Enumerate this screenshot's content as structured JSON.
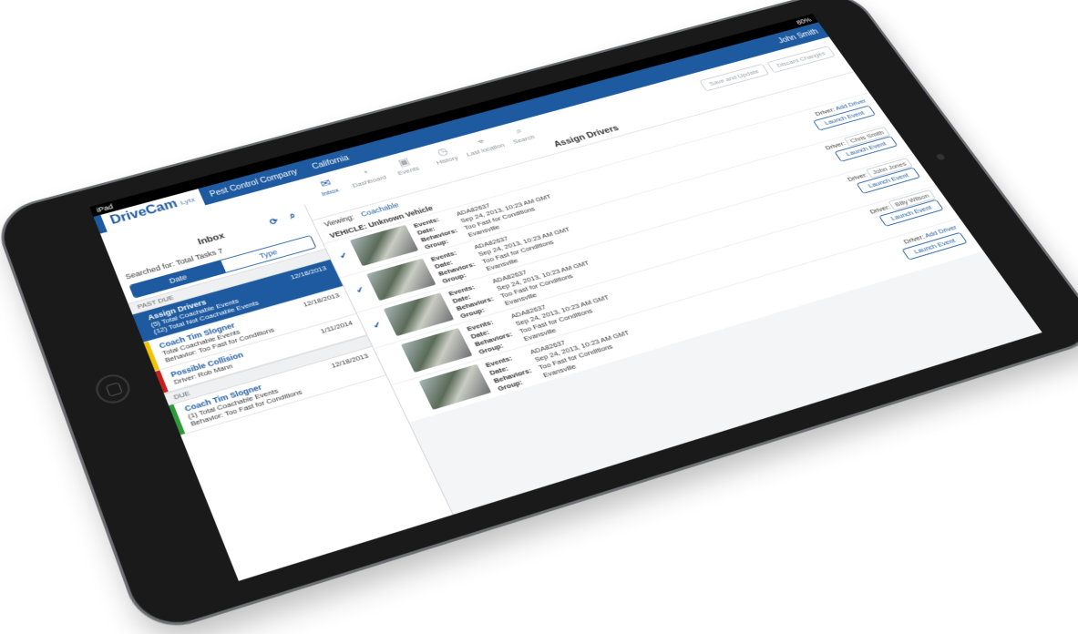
{
  "statusbar": {
    "device": "iPad",
    "battery": "80%"
  },
  "header": {
    "logo": "DriveCam",
    "logo_sub": "Lytx",
    "company": "Pest Control Company",
    "region": "California",
    "user": "John Smith"
  },
  "nav": {
    "items": [
      {
        "label": "Inbox",
        "icon": "inbox-icon"
      },
      {
        "label": "Dashboard",
        "icon": "dashboard-icon"
      },
      {
        "label": "Events",
        "icon": "events-icon"
      },
      {
        "label": "History",
        "icon": "history-icon"
      },
      {
        "label": "Last location",
        "icon": "location-icon"
      },
      {
        "label": "Search",
        "icon": "search-icon"
      }
    ],
    "save_label": "Save and Update",
    "discard_label": "Discard Changes"
  },
  "sidebar": {
    "title": "Inbox",
    "searched": "Searched for: Total Tasks 7",
    "seg_date": "Date",
    "seg_type": "Type",
    "past_due": "PAST DUE",
    "due": "DUE",
    "tasks": [
      {
        "title": "Assign Drivers",
        "line1": "(5) Total Coachable Events",
        "line2": "(12) Total Not Coachable Events",
        "date": "12/18/2013",
        "color": "#1d5aa0"
      },
      {
        "title": "Coach Tim Slogner",
        "line1": "Total Coachable Events",
        "line2": "Behavior: Too Fast for Conditions",
        "date": "12/18/2013",
        "color": "#f2c200"
      },
      {
        "title": "Possible Collision",
        "line1": "Driver: Rob Mann",
        "line2": "",
        "date": "1/11/2014",
        "color": "#c8201e"
      },
      {
        "title": "Coach Tim Slogner",
        "line1": "(1) Total Coachable Events",
        "line2": "Behavior: Too Fast for Conditions",
        "date": "12/18/2013",
        "color": "#2e9a3b"
      }
    ]
  },
  "main": {
    "title": "Assign Drivers",
    "viewing_label": "Viewing:",
    "viewing_value": "Coachable",
    "vehicle": "VEHICLE: Unknown Vehicle",
    "driver_label": "Driver:",
    "add_driver": "Add Driver",
    "launch": "Launch Event",
    "events": [
      {
        "events": "ADA82637",
        "date": "Sep 24, 2013, 10:23 AM GMT",
        "behaviors": "Too Fast for Conditions",
        "group": "Evansville",
        "driver": "",
        "checked": true
      },
      {
        "events": "ADA82637",
        "date": "Sep 24, 2013, 10:23 AM GMT",
        "behaviors": "Too Fast for Conditions",
        "group": "Evansville",
        "driver": "Chris Smith",
        "checked": true
      },
      {
        "events": "ADA82637",
        "date": "Sep 24, 2013, 10:23 AM GMT",
        "behaviors": "Too Fast for Conditions",
        "group": "Evansville",
        "driver": "John Jones",
        "checked": true
      },
      {
        "events": "ADA82637",
        "date": "Sep 24, 2013, 10:23 AM GMT",
        "behaviors": "Too Fast for Conditions",
        "group": "Evansville",
        "driver": "Billy Wilson",
        "checked": false
      },
      {
        "events": "ADA82637",
        "date": "Sep 24, 2013, 10:23 AM GMT",
        "behaviors": "Too Fast for Conditions",
        "group": "Evansville",
        "driver": "",
        "checked": false
      }
    ]
  }
}
